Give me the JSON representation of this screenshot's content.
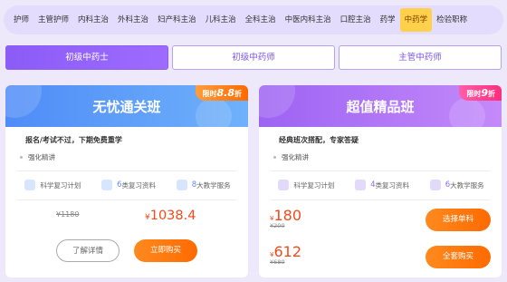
{
  "nav": {
    "items": [
      {
        "label": "护师"
      },
      {
        "label": "主管护师"
      },
      {
        "label": "内科主治"
      },
      {
        "label": "外科主治"
      },
      {
        "label": "妇产科主治"
      },
      {
        "label": "儿科主治"
      },
      {
        "label": "全科主治"
      },
      {
        "label": "中医内科主治"
      },
      {
        "label": "口腔主治"
      },
      {
        "label": "药学"
      },
      {
        "label": "中药学",
        "active": true
      },
      {
        "label": "检验职称"
      }
    ]
  },
  "tabs": [
    {
      "label": "初级中药士",
      "active": true
    },
    {
      "label": "初级中药师"
    },
    {
      "label": "主管中药师"
    }
  ],
  "cards": {
    "left": {
      "title": "无忧通关班",
      "badge_prefix": "限时",
      "badge_value": "8.8",
      "badge_suffix": "折",
      "subtitle": "报名/考试不过，下期免费重学",
      "feature": "强化精讲",
      "services": [
        {
          "icon": "book-icon",
          "num": "",
          "label": "科学复习计划"
        },
        {
          "icon": "video-icon",
          "num": "6",
          "label": "类复习资料"
        },
        {
          "icon": "heart-icon",
          "num": "8",
          "label": "大教学服务"
        }
      ],
      "old_price": "¥1180",
      "currency": "¥",
      "new_price": "1038.4",
      "detail_label": "了解详情",
      "buy_label": "立即购买"
    },
    "right": {
      "title": "超值精品班",
      "badge_prefix": "限时",
      "badge_value": "9",
      "badge_suffix": "折",
      "subtitle": "经典班次搭配，专家答疑",
      "feature": "强化精讲",
      "services": [
        {
          "icon": "book-icon",
          "num": "",
          "label": "科学复习计划"
        },
        {
          "icon": "video-icon",
          "num": "4",
          "label": "类复习资料"
        },
        {
          "icon": "heart-icon",
          "num": "6",
          "label": "大教学服务"
        }
      ],
      "single": {
        "currency": "¥",
        "price": "180",
        "old": "¥200",
        "button": "选择单科"
      },
      "full": {
        "currency": "¥",
        "price": "612",
        "old": "¥680",
        "button": "全套购买"
      }
    }
  },
  "colors": {
    "accent_purple": "#8b5cf6",
    "blue_header": "#4f8cf7",
    "purple_header": "#9d63f3",
    "price_red": "#f04a1c",
    "button_orange": "#ff7a0a",
    "nav_active": "#ffd04a"
  }
}
